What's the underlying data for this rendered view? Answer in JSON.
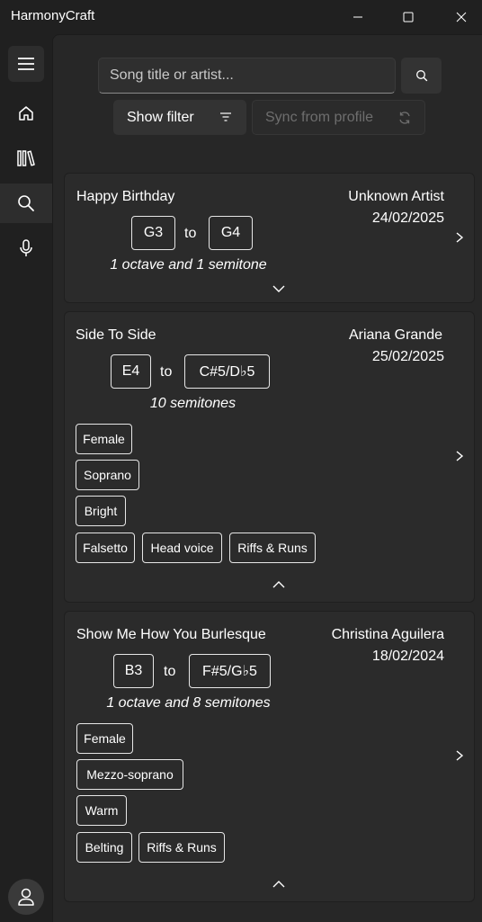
{
  "app": {
    "title": "HarmonyCraft"
  },
  "window_controls": [
    "minimize",
    "maximize",
    "close"
  ],
  "sidebar": {
    "items": [
      {
        "icon": "hamburger-icon"
      },
      {
        "icon": "home-icon"
      },
      {
        "icon": "library-icon"
      },
      {
        "icon": "search-icon",
        "active": true
      },
      {
        "icon": "microphone-icon"
      }
    ],
    "footer_icon": "user-icon"
  },
  "search": {
    "placeholder": "Song title or artist...",
    "value": ""
  },
  "toolbar": {
    "filter_label": "Show filter",
    "sync_label": "Sync from profile",
    "sync_enabled": false
  },
  "songs": [
    {
      "title": "Happy Birthday",
      "artist": "Unknown Artist",
      "date": "24/02/2025",
      "low_note": "G3",
      "to": "to",
      "high_note": "G4",
      "range": "1 octave and 1 semitone",
      "expanded": false,
      "tags": []
    },
    {
      "title": "Side To Side",
      "artist": "Ariana Grande",
      "date": "25/02/2025",
      "low_note": "E4",
      "to": "to",
      "high_note": "C#5/D♭5",
      "range": "10 semitones",
      "expanded": true,
      "tags": [
        "Female",
        "Soprano",
        "Bright",
        "Falsetto",
        "Head voice",
        "Riffs & Runs"
      ]
    },
    {
      "title": "Show Me How You Burlesque",
      "artist": "Christina Aguilera",
      "date": "18/02/2024",
      "low_note": "B3",
      "to": "to",
      "high_note": "F#5/G♭5",
      "range": "1 octave and 8 semitones",
      "expanded": true,
      "tags": [
        "Female",
        "Mezzo-soprano",
        "Warm",
        "Belting",
        "Riffs & Runs"
      ]
    }
  ],
  "colors": {
    "background": "#202020",
    "content_background": "#272727",
    "card_background": "#2b2b2b",
    "text": "#ffffff",
    "disabled_text": "#6e6e6e"
  }
}
